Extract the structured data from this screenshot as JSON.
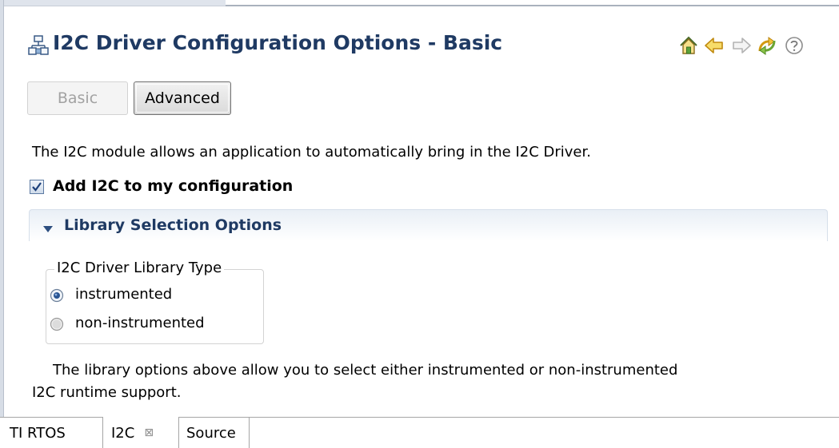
{
  "header": {
    "title": "I2C Driver Configuration Options - Basic",
    "icons": [
      "config-icon",
      "home-icon",
      "back-arrow-icon",
      "forward-arrow-icon",
      "refresh-icon",
      "help-icon"
    ]
  },
  "view_buttons": {
    "basic_label": "Basic",
    "advanced_label": "Advanced",
    "basic_state": "disabled"
  },
  "description": "The I2C module allows an application to automatically bring in the I2C Driver.",
  "add_module": {
    "label": "Add I2C to my configuration",
    "checked": true
  },
  "library_section": {
    "title": "Library Selection Options",
    "expanded": true,
    "group_label": "I2C Driver Library Type",
    "options": [
      {
        "label": "instrumented",
        "selected": true
      },
      {
        "label": "non-instrumented",
        "selected": false
      }
    ],
    "footnote_line1": "The library options above allow you to select either instrumented or non-instrumented",
    "footnote_line2": "I2C runtime support."
  },
  "tabs": [
    {
      "label": "TI RTOS",
      "active": false
    },
    {
      "label": "I2C",
      "active": true,
      "close_glyph": "⊠"
    },
    {
      "label": "Source",
      "active": false
    }
  ],
  "colors": {
    "title_blue": "#1f3a63",
    "section_gradient_top": "#e9eff6",
    "disabled_text": "#a2a2a2"
  }
}
